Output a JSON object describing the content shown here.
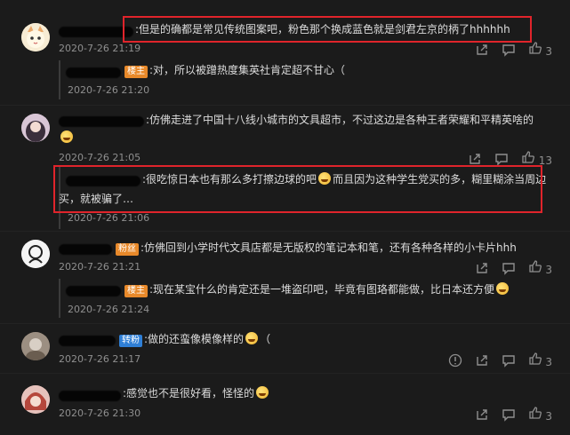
{
  "comments": [
    {
      "text": "但是的确都是常见传统图案吧，粉色那个换成蓝色就是剑君左京的柄了hhhhhh",
      "time": "2020-7-26 21:19",
      "likes": "3"
    },
    {
      "badge": "楼主",
      "text": "对，所以被蹭热度集英社肯定超不甘心（",
      "time": "2020-7-26 21:20"
    },
    {
      "text_1": "仿佛走进了中国十八线小城市的文具超市，不过这边是各种王者荣耀和平精英啥的",
      "time": "2020-7-26 21:05",
      "likes": "13"
    },
    {
      "text_a": "很吃惊日本也有那么多打擦边球的吧",
      "text_b": "而且因为这种学生党买的多，糊里糊涂当周边",
      "text_c": "买，就被骗了…",
      "time": "2020-7-26 21:06"
    },
    {
      "badge": "粉丝",
      "text": "仿佛回到小学时代文具店都是无版权的笔记本和笔，还有各种各样的小卡片hhh",
      "time": "2020-7-26 21:21",
      "likes": "3"
    },
    {
      "badge": "楼主",
      "text": "现在某宝什么的肯定还是一堆盗印吧，毕竟有图珞都能做，比日本还方便",
      "time": "2020-7-26 21:24"
    },
    {
      "badge": "转粉",
      "text": "做的还蛮像模像样的",
      "text_after": "（",
      "time": "2020-7-26 21:17",
      "likes": "3"
    },
    {
      "text": "感觉也不是很好看，怪怪的",
      "time": "2020-7-26 21:30",
      "likes": "3"
    }
  ],
  "colors": {
    "background": "#1b1b1b",
    "highlight": "#e0242b",
    "badge_owner": "#e8892a",
    "badge_fan": "#2f7fd6"
  }
}
